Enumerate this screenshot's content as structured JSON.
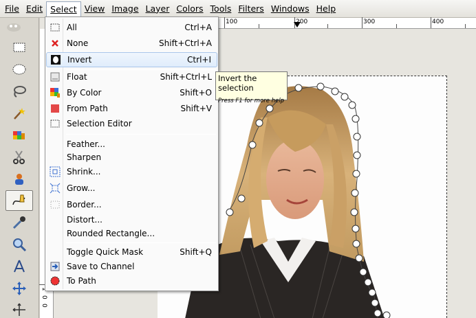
{
  "menubar": {
    "items": [
      {
        "label": "File",
        "active": false
      },
      {
        "label": "Edit",
        "active": false
      },
      {
        "label": "Select",
        "active": true
      },
      {
        "label": "View",
        "active": false
      },
      {
        "label": "Image",
        "active": false
      },
      {
        "label": "Layer",
        "active": false
      },
      {
        "label": "Colors",
        "active": false
      },
      {
        "label": "Tools",
        "active": false
      },
      {
        "label": "Filters",
        "active": false
      },
      {
        "label": "Windows",
        "active": false
      },
      {
        "label": "Help",
        "active": false
      }
    ]
  },
  "ruler": {
    "top_labels": [
      "100",
      "200",
      "300",
      "400"
    ],
    "left_labels": [
      "1",
      "0",
      "0"
    ]
  },
  "select_menu": {
    "items": [
      {
        "label": "All",
        "shortcut": "Ctrl+A",
        "icon": "select-all-icon"
      },
      {
        "label": "None",
        "shortcut": "Shift+Ctrl+A",
        "icon": "select-none-icon"
      },
      {
        "label": "Invert",
        "shortcut": "Ctrl+I",
        "icon": "invert-selection-icon",
        "hover": true
      },
      {
        "label": "Float",
        "shortcut": "Shift+Ctrl+L",
        "icon": "float-selection-icon"
      },
      {
        "label": "By Color",
        "shortcut": "Shift+O",
        "icon": "select-by-color-icon"
      },
      {
        "label": "From Path",
        "shortcut": "Shift+V",
        "icon": "from-path-icon"
      },
      {
        "label": "Selection Editor",
        "shortcut": "",
        "icon": "selection-editor-icon"
      },
      {
        "label": "Feather...",
        "shortcut": "",
        "icon": ""
      },
      {
        "label": "Sharpen",
        "shortcut": "",
        "icon": ""
      },
      {
        "label": "Shrink...",
        "shortcut": "",
        "icon": "shrink-icon"
      },
      {
        "label": "Grow...",
        "shortcut": "",
        "icon": "grow-icon"
      },
      {
        "label": "Border...",
        "shortcut": "",
        "icon": "border-icon"
      },
      {
        "label": "Distort...",
        "shortcut": "",
        "icon": ""
      },
      {
        "label": "Rounded Rectangle...",
        "shortcut": "",
        "icon": ""
      },
      {
        "label": "Toggle Quick Mask",
        "shortcut": "Shift+Q",
        "icon": ""
      },
      {
        "label": "Save to Channel",
        "shortcut": "",
        "icon": "save-to-channel-icon"
      },
      {
        "label": "To Path",
        "shortcut": "",
        "icon": "to-path-icon"
      }
    ]
  },
  "tooltip": {
    "title": "Invert the selection",
    "hint": "Press F1 for more help"
  },
  "colors": {
    "menu_hover": "#dfecfb",
    "tooltip_bg": "#ffffe1",
    "red_icon": "#e03030"
  }
}
